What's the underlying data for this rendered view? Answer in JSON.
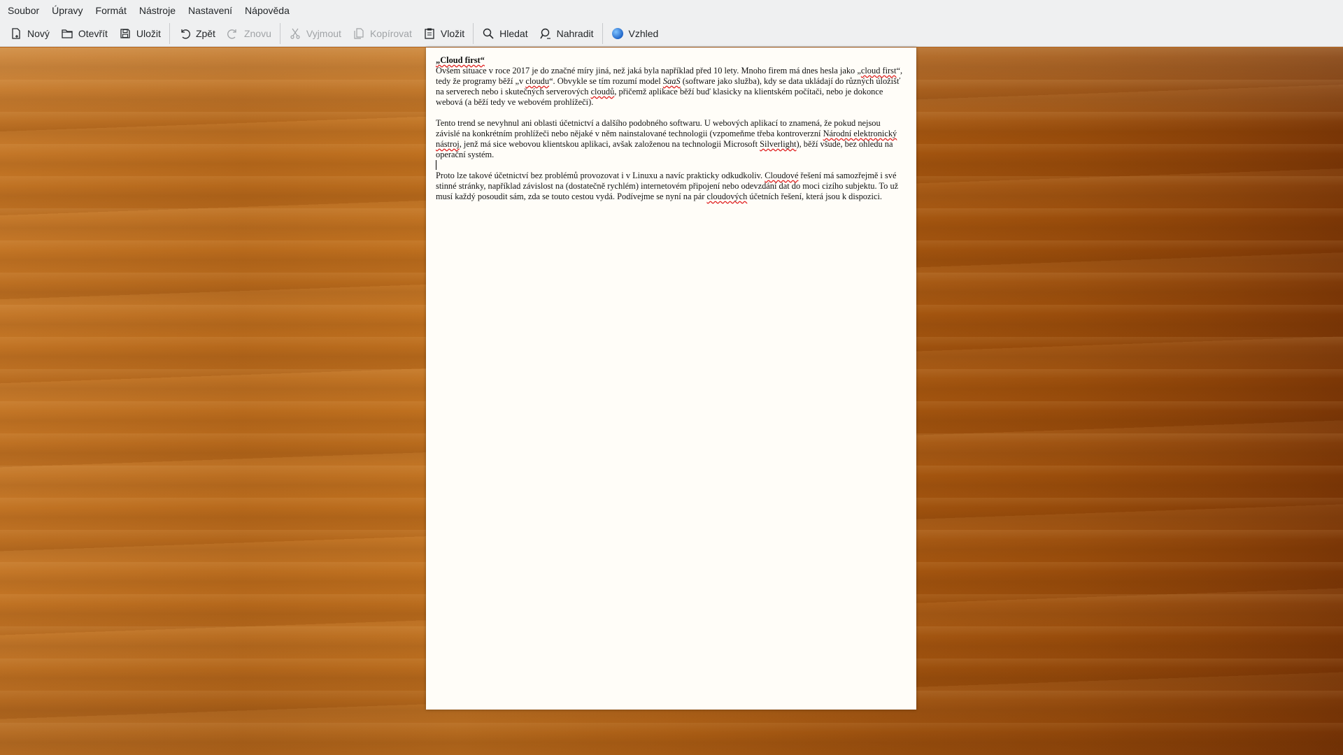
{
  "menu": [
    "Soubor",
    "Úpravy",
    "Formát",
    "Nástroje",
    "Nastavení",
    "Nápověda"
  ],
  "toolbar": {
    "new": "Nový",
    "open": "Otevřít",
    "save": "Uložit",
    "undo": "Zpět",
    "redo": "Znovu",
    "cut": "Vyjmout",
    "copy": "Kopírovat",
    "paste": "Vložit",
    "find": "Hledat",
    "replace": "Nahradit",
    "appearance": "Vzhled"
  },
  "document": {
    "title": "„Cloud first“",
    "p1": [
      "Ovšem situace v roce 2017 je do značné míry jiná, než jaká byla například před 10 lety. Mnoho firem má dnes hesla jako „",
      "cloud first",
      "“, tedy že programy běží „v ",
      "cloudu",
      "“. Obvykle se tím rozumí model ",
      "SaaS",
      " (software jako služba), kdy se data ukládají do různých úložišť na serverech nebo i skutečných serverových ",
      "cloudů",
      ", přičemž aplikace běží buď klasicky na klientském počítači, nebo je dokonce webová (a běží tedy ve webovém prohlížeči)."
    ],
    "p2": [
      "Tento trend se nevyhnul ani oblasti účetnictví a dalšího podobného softwaru. U webových aplikací to znamená, že pokud nejsou závislé na konkrétním prohlížeči nebo nějaké v něm nainstalované technologii (vzpomeňme třeba kontroverzní ",
      "Národní elektronický nástroj",
      ", jenž má sice webovou klientskou aplikaci, avšak založenou na technologii Microsoft ",
      "Silverlight",
      "), běží všude, bez ohledu na operační systém."
    ],
    "p3": [
      "Proto lze takové účetnictví bez problémů provozovat i v Linuxu a navíc prakticky odkudkoliv. ",
      "Cloudové",
      " řešení má samozřejmě i své stinné stránky, například závislost na (dostatečně rychlém) internetovém připojení nebo odevzdání dat do moci cizího subjektu. To už musí každý posoudit sám, zda se touto cestou vydá. Podívejme se nyní na pár ",
      "cloudových",
      " účetních řešení, která jsou k dispozici."
    ]
  }
}
